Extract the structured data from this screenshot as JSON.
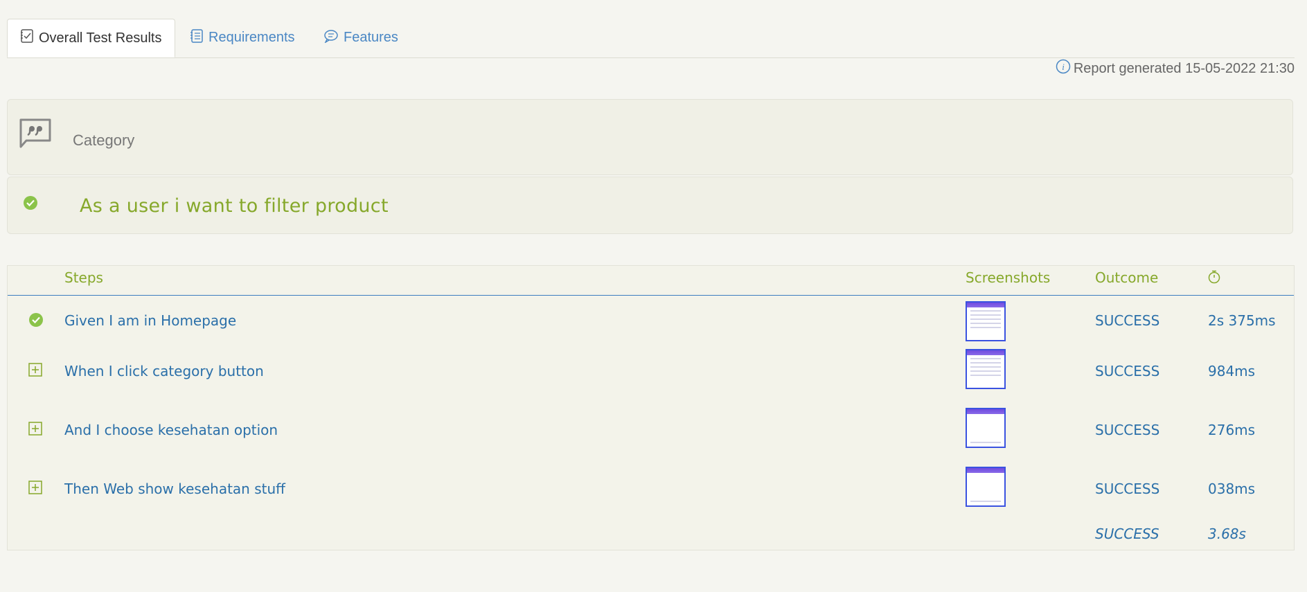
{
  "tabs": [
    {
      "label": "Overall Test Results",
      "icon": "checklist-icon",
      "active": true
    },
    {
      "label": "Requirements",
      "icon": "book-icon",
      "active": false
    },
    {
      "label": "Features",
      "icon": "comment-icon",
      "active": false
    }
  ],
  "report": {
    "generated": "Report generated 15-05-2022 21:30",
    "icon": "info-icon"
  },
  "category": {
    "label": "Category",
    "icon": "quote-bubble-icon"
  },
  "scenario": {
    "title": "As a user i want to filter product",
    "status_icon": "check-circle-icon"
  },
  "table": {
    "headers": {
      "steps": "Steps",
      "screenshots": "Screenshots",
      "outcome": "Outcome",
      "duration_icon": "stopwatch-icon"
    },
    "rows": [
      {
        "step": "Given I am in Homepage",
        "outcome": "SUCCESS",
        "duration": "2s 375ms",
        "icon": "check-circle-icon"
      },
      {
        "step": "When I click category button",
        "outcome": "SUCCESS",
        "duration": "984ms",
        "icon": "expand-plus-icon"
      },
      {
        "step": "And I choose kesehatan option",
        "outcome": "SUCCESS",
        "duration": "276ms",
        "icon": "expand-plus-icon"
      },
      {
        "step": "Then Web show kesehatan stuff",
        "outcome": "SUCCESS",
        "duration": "038ms",
        "icon": "expand-plus-icon"
      }
    ],
    "total": {
      "outcome": "SUCCESS",
      "duration": "3.68s"
    }
  },
  "colors": {
    "accent_green": "#86a82b",
    "link_blue": "#2a6fa9",
    "tab_blue": "#4a87c4"
  }
}
